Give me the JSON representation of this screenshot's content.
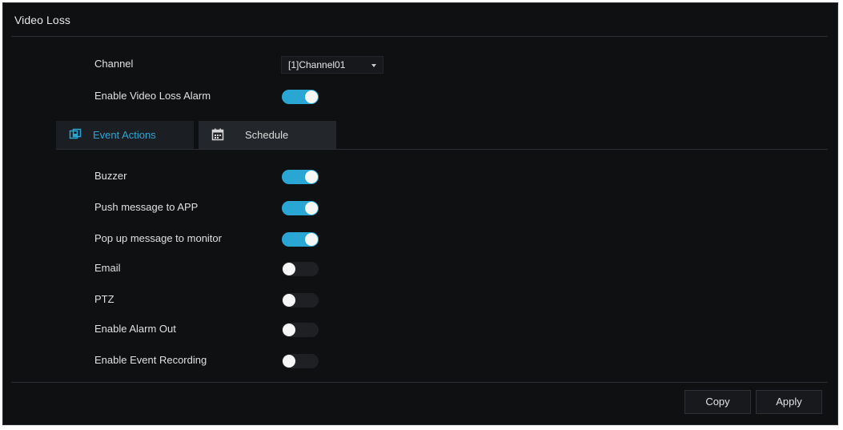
{
  "page": {
    "title": "Video Loss"
  },
  "settings": {
    "channel_label": "Channel",
    "channel_value": "[1]Channel01",
    "enable_label": "Enable Video Loss Alarm",
    "enable_on": true
  },
  "tabs": [
    {
      "label": "Event Actions",
      "icon": "event-actions-icon",
      "active": true
    },
    {
      "label": "Schedule",
      "icon": "calendar-icon",
      "active": false
    }
  ],
  "actions": [
    {
      "label": "Buzzer",
      "on": true
    },
    {
      "label": "Push message to APP",
      "on": true
    },
    {
      "label": "Pop up message to monitor",
      "on": true
    },
    {
      "label": "Email",
      "on": false
    },
    {
      "label": "PTZ",
      "on": false
    },
    {
      "label": "Enable Alarm Out",
      "on": false
    },
    {
      "label": "Enable Event Recording",
      "on": false
    }
  ],
  "footer": {
    "copy_label": "Copy",
    "apply_label": "Apply"
  },
  "colors": {
    "accent": "#2aa6d4",
    "background": "#0f1012",
    "toggle_off": "#1e2024"
  }
}
